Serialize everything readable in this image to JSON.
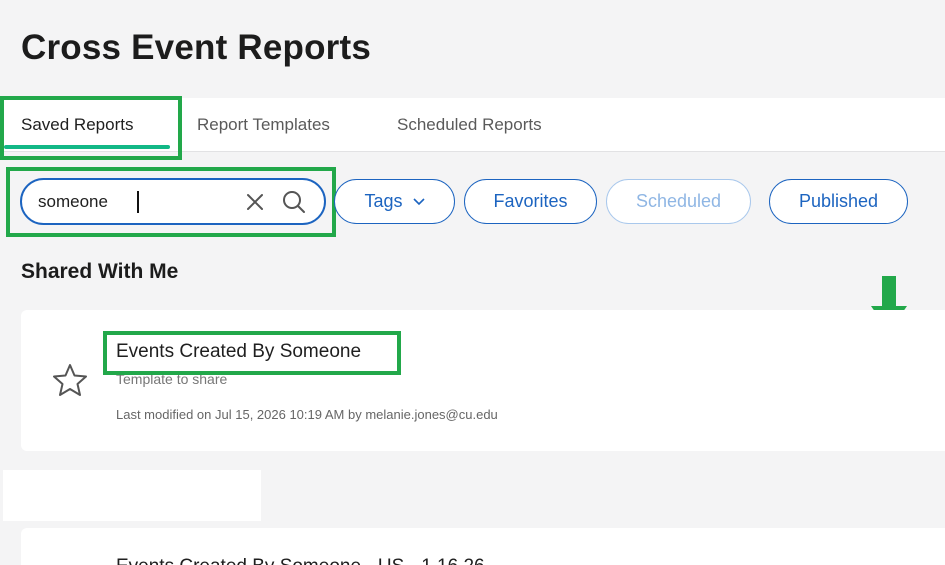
{
  "page": {
    "title": "Cross Event Reports"
  },
  "tabs": [
    {
      "label": "Saved Reports",
      "active": true
    },
    {
      "label": "Report Templates",
      "active": false
    },
    {
      "label": "Scheduled Reports",
      "active": false
    }
  ],
  "search": {
    "value": "someone",
    "clear_icon": "close-icon",
    "search_icon": "search-icon"
  },
  "filters": {
    "tags": "Tags",
    "favorites": "Favorites",
    "scheduled": "Scheduled",
    "published": "Published"
  },
  "section": {
    "title": "Shared With Me"
  },
  "reports": [
    {
      "title": "Events Created By Someone",
      "subtitle": "Template to share",
      "meta": "Last modified on Jul 15, 2026 10:19 AM by melanie.jones@cu.edu"
    },
    {
      "title": "Events Created By Someone - US - 1.16.26"
    }
  ],
  "colors": {
    "accent": "#1c64c0",
    "tab_underline": "#12b886",
    "annotation": "#22a84a"
  }
}
